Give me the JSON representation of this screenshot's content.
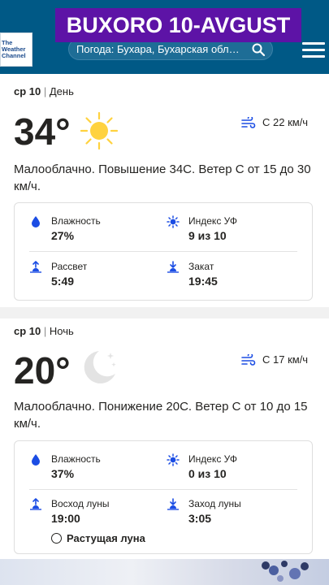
{
  "banner": "BUXORO 10-AVGUST",
  "header": {
    "logo_text": "The Weather Channel",
    "search_value": "Погода: Бухара, Бухарская обл…",
    "brand_color": "#005986"
  },
  "day": {
    "date": "ср 10",
    "period": "День",
    "temperature": "34°",
    "wind": "С 22 км/ч",
    "description": "Малооблачно. Повышение 34C. Ветер С от 15 до 30 км/ч.",
    "humidity_label": "Влажность",
    "humidity_value": "27%",
    "uv_label": "Индекс УФ",
    "uv_value": "9 из 10",
    "sunrise_label": "Рассвет",
    "sunrise_value": "5:49",
    "sunset_label": "Закат",
    "sunset_value": "19:45"
  },
  "night": {
    "date": "ср 10",
    "period": "Ночь",
    "temperature": "20°",
    "wind": "С 17 км/ч",
    "description": "Малооблачно. Понижение 20C. Ветер С от 10 до 15 км/ч.",
    "humidity_label": "Влажность",
    "humidity_value": "37%",
    "uv_label": "Индекс УФ",
    "uv_value": "0 из 10",
    "moonrise_label": "Восход луны",
    "moonrise_value": "19:00",
    "moonset_label": "Заход луны",
    "moonset_value": "3:05",
    "moon_phase": "Растущая луна"
  },
  "colors": {
    "icon_blue": "#1b4de4",
    "sun_yellow": "#ffd23f",
    "banner_purple": "#5d13a6"
  }
}
